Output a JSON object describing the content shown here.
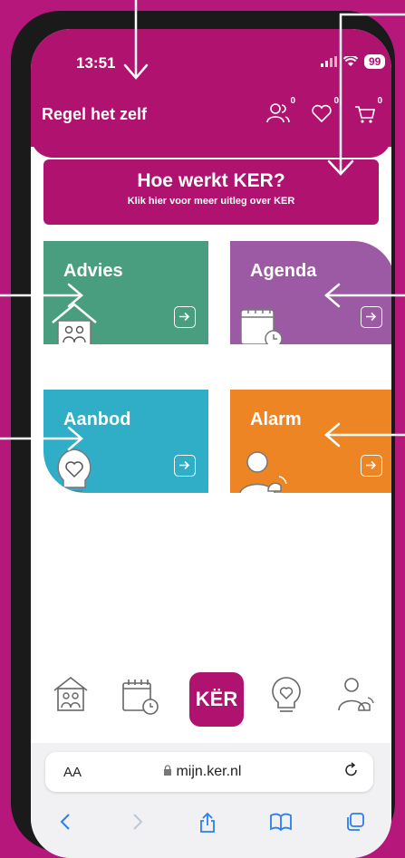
{
  "status": {
    "time": "13:51",
    "battery": "99"
  },
  "header": {
    "title": "Regel het zelf",
    "counts": {
      "profile": "0",
      "favorites": "0",
      "cart": "0"
    }
  },
  "info_button": {
    "title": "Hoe werkt KER?",
    "subtitle": "Klik hier voor meer uitleg over KER"
  },
  "tiles": {
    "advies": "Advies",
    "agenda": "Agenda",
    "aanbod": "Aanbod",
    "alarm": "Alarm"
  },
  "nav": {
    "ker_label": "KËR"
  },
  "browser": {
    "text_size": "AA",
    "domain": "mijn.ker.nl"
  },
  "colors": {
    "brand": "#b0126f",
    "advies": "#4a9e80",
    "agenda": "#9b5aa3",
    "aanbod": "#31aec7",
    "alarm": "#ee8525",
    "background": "#b5187a",
    "ios_blue": "#2a7ef0"
  },
  "icons": [
    "house-people-icon",
    "calendar-clock-icon",
    "lightbulb-heart-icon",
    "person-alarm-icon",
    "profile-icon",
    "heart-icon",
    "cart-icon",
    "arrow-right-icon",
    "share-icon",
    "bookmarks-icon",
    "tabs-icon"
  ]
}
